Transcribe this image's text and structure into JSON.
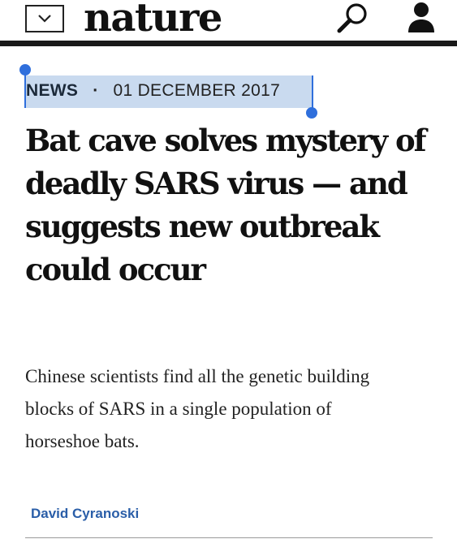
{
  "header": {
    "logo": "nature",
    "menu_icon": "chevron-down-icon",
    "search_icon": "search-icon",
    "account_icon": "user-icon"
  },
  "article": {
    "type": "NEWS",
    "separator": "·",
    "date": "01 DECEMBER 2017",
    "headline": "Bat cave solves mystery of deadly SARS virus — and suggests new outbreak could occur",
    "standfirst": "Chinese scientists find all the genetic building blocks of SARS in a single population of horseshoe bats.",
    "author": "David Cyranoski"
  },
  "selection": {
    "highlight_color": "#c9daef",
    "handle_color": "#2f6fdc"
  },
  "colors": {
    "author_link": "#2a5ea8",
    "text": "#111111"
  }
}
